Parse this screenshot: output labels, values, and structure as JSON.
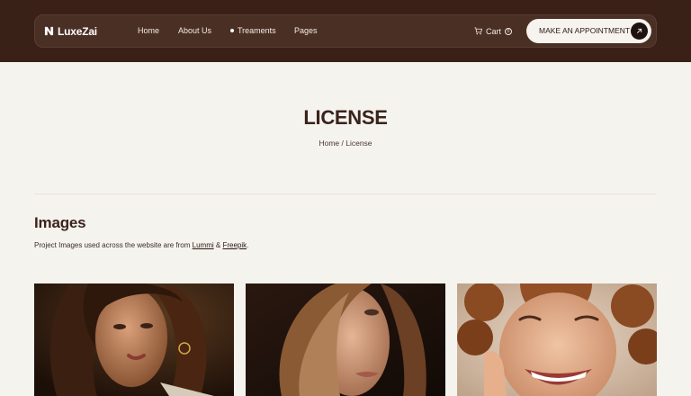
{
  "brand": {
    "name": "LuxeZai"
  },
  "nav": {
    "items": [
      {
        "label": "Home"
      },
      {
        "label": "About Us"
      },
      {
        "label": "Treaments"
      },
      {
        "label": "Pages"
      }
    ],
    "cart_label": "Cart",
    "cart_count": "0",
    "cta_label": "MAKE AN APPOINTMENT"
  },
  "hero": {
    "title": "LICENSE",
    "breadcrumb_home": "Home",
    "breadcrumb_separator": " / ",
    "breadcrumb_current": "License"
  },
  "images_section": {
    "heading": "Images",
    "text_before": "Project Images used across the website are from ",
    "link_1": "Lummi",
    "text_between": " & ",
    "link_2": "Freepik",
    "text_after": "."
  },
  "gallery": [
    {
      "icon": "portrait-photo"
    },
    {
      "icon": "portrait-photo"
    },
    {
      "icon": "portrait-photo"
    }
  ],
  "colors": {
    "header_bg": "#3a2118",
    "navbar_bg": "#4a2f25",
    "page_bg": "#f5f3ee",
    "title_text": "#3a231c",
    "cta_bg": "#f7f3ee"
  }
}
